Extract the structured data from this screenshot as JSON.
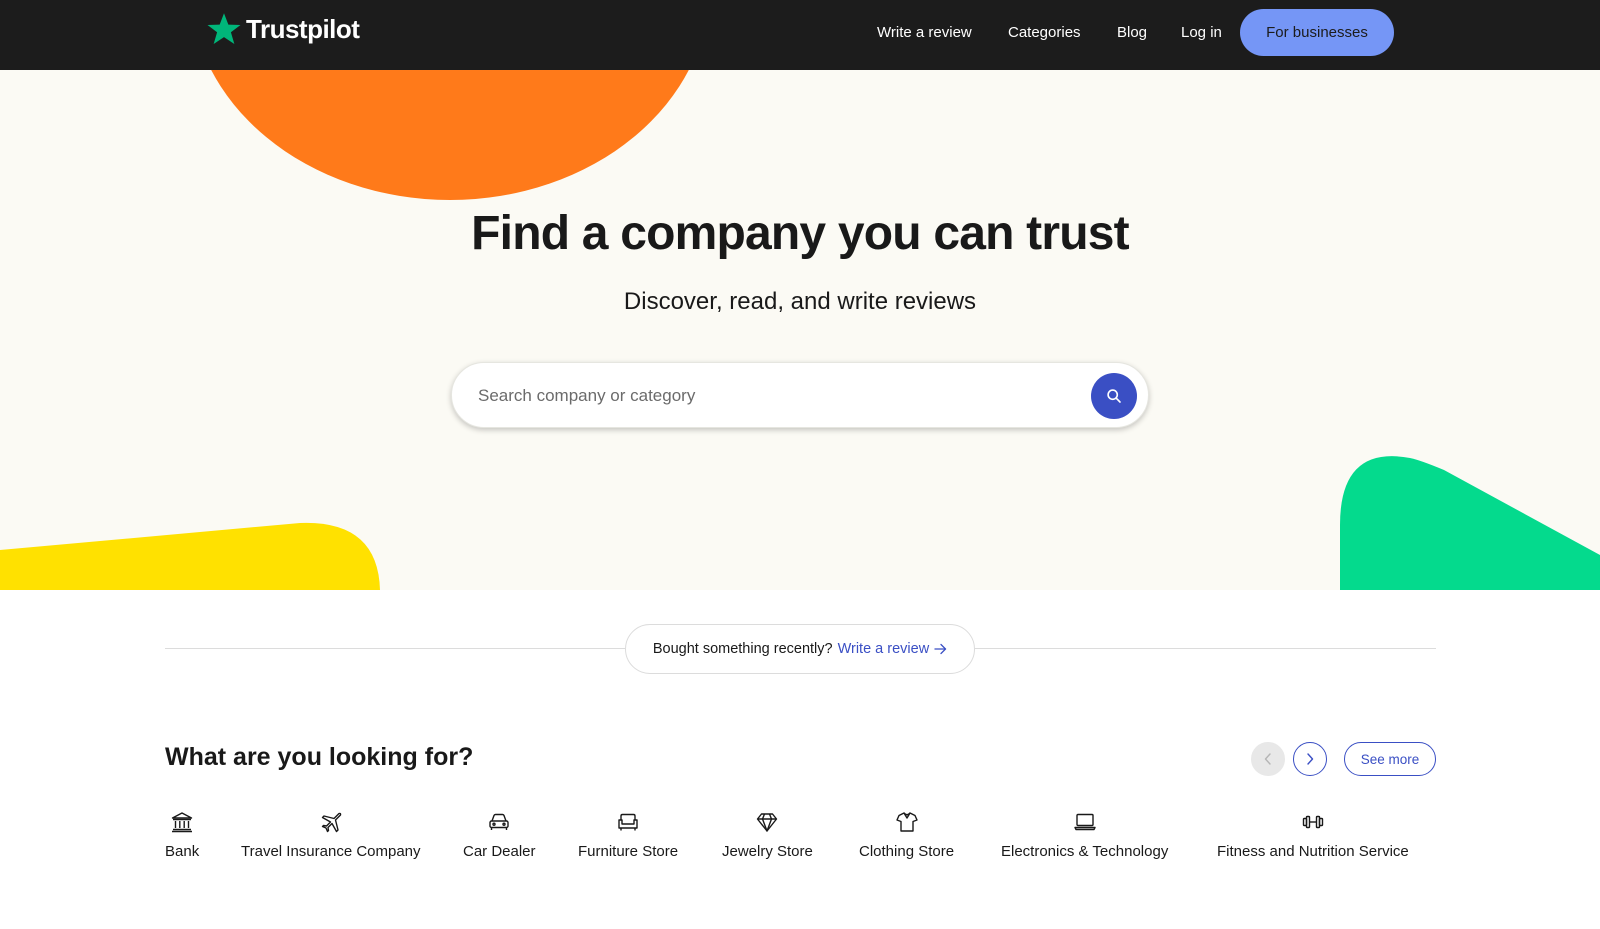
{
  "brand": {
    "name": "Trustpilot",
    "star_color": "#00b67a"
  },
  "nav": {
    "links": [
      {
        "label": "Write a review"
      },
      {
        "label": "Categories"
      },
      {
        "label": "Blog"
      },
      {
        "label": "Log in"
      }
    ],
    "cta_label": "For businesses"
  },
  "hero": {
    "title": "Find a company you can trust",
    "subtitle": "Discover, read, and write reviews",
    "search": {
      "placeholder": "Search company or category",
      "value": "",
      "icon": "search-icon"
    }
  },
  "prompt": {
    "text": "Bought something recently?",
    "link_label": "Write a review",
    "link_icon": "arrow-right-icon"
  },
  "categories": {
    "heading": "What are you looking for?",
    "see_more_label": "See more",
    "items": [
      {
        "label": "Bank",
        "icon": "bank-icon"
      },
      {
        "label": "Travel Insurance Company",
        "icon": "airplane-icon"
      },
      {
        "label": "Car Dealer",
        "icon": "car-icon"
      },
      {
        "label": "Furniture Store",
        "icon": "sofa-icon"
      },
      {
        "label": "Jewelry Store",
        "icon": "diamond-icon"
      },
      {
        "label": "Clothing Store",
        "icon": "shirt-icon"
      },
      {
        "label": "Electronics & Technology",
        "icon": "laptop-icon"
      },
      {
        "label": "Fitness and Nutrition Service",
        "icon": "dumbbell-icon"
      }
    ]
  },
  "colors": {
    "nav_bg": "#1c1c1c",
    "hero_bg": "#fbfaf4",
    "accent_blue": "#3a4fc4",
    "cta_blue": "#7596f6",
    "orange": "#ff7a1a",
    "yellow": "#ffe100",
    "green": "#04da8d"
  }
}
